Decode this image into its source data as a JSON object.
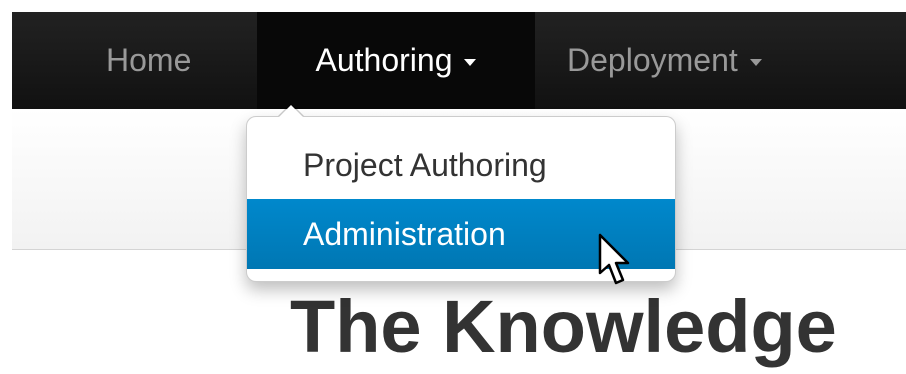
{
  "navbar": {
    "items": [
      {
        "label": "Home"
      },
      {
        "label": "Authoring",
        "has_caret": true,
        "active": true
      },
      {
        "label": "Deployment",
        "has_caret": true
      }
    ]
  },
  "dropdown": {
    "items": [
      {
        "label": "Project Authoring"
      },
      {
        "label": "Administration",
        "highlighted": true
      }
    ]
  },
  "main": {
    "heading": "The Knowledge"
  },
  "colors": {
    "navbar_bg": "#1b1b1b",
    "active_item_bg": "#080808",
    "highlight": "#0088cc",
    "heading": "#333333"
  },
  "icons": {
    "caret": "caret-down-icon",
    "cursor": "mouse-pointer-icon"
  }
}
